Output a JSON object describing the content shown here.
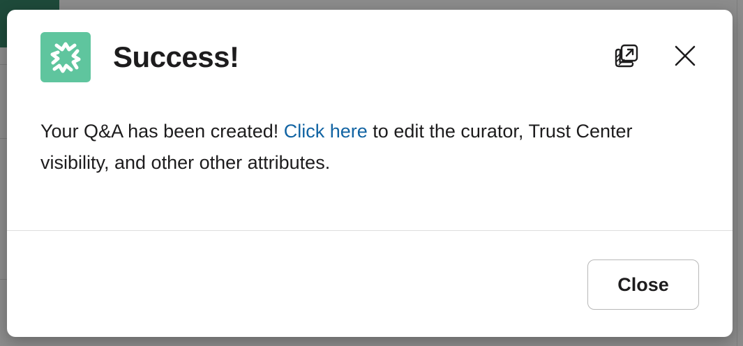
{
  "modal": {
    "title": "Success!",
    "app_icon": "burst-logo-icon",
    "header_actions": {
      "open_in_new_window_icon": "open-in-new-window-icon",
      "close_icon": "close-icon"
    },
    "message": {
      "before_link": "Your Q&A has been created! ",
      "link_text": "Click here",
      "after_link": " to edit the curator, Trust Center visibility, and other other attributes."
    },
    "footer": {
      "close_label": "Close"
    }
  },
  "colors": {
    "app_icon_bg": "#5fc59e",
    "link": "#1264a3",
    "text": "#1d1c1d",
    "backdrop": "#8c8c8c"
  }
}
